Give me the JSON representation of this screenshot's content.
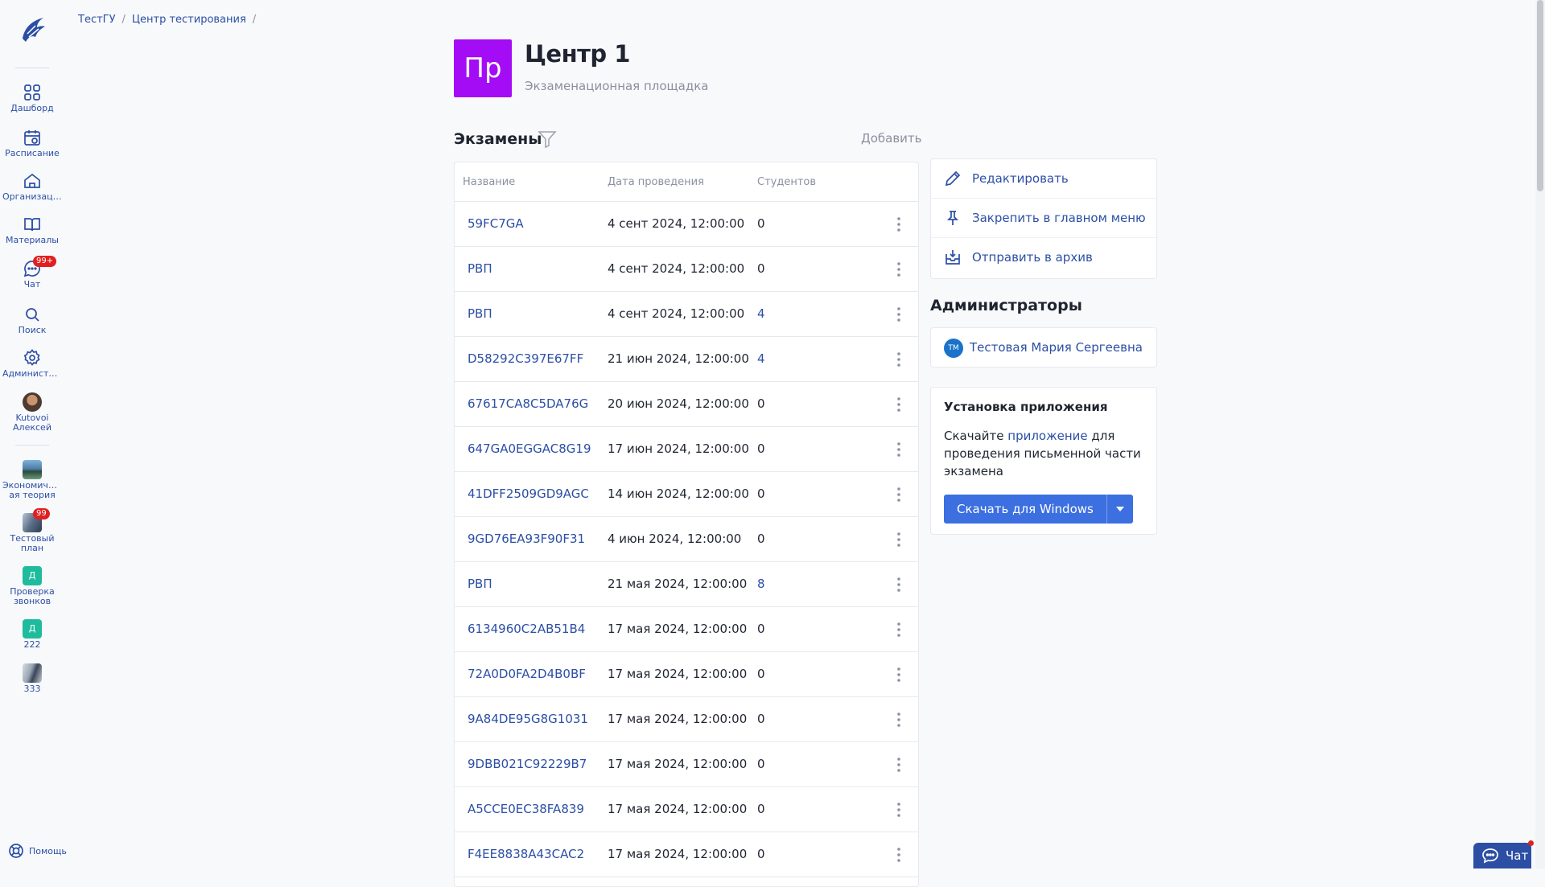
{
  "breadcrumb": {
    "items": [
      "ТестГУ",
      "Центр тестирования"
    ],
    "separator": "/"
  },
  "sidebar": {
    "nav": [
      {
        "label": "Дашборд",
        "icon": "dashboard-icon"
      },
      {
        "label": "Расписание",
        "icon": "calendar-icon"
      },
      {
        "label": "Организация",
        "icon": "organization-icon"
      },
      {
        "label": "Материалы",
        "icon": "book-icon"
      },
      {
        "label": "Чат",
        "icon": "chat-icon",
        "badge": "99+"
      },
      {
        "label": "Поиск",
        "icon": "search-icon"
      },
      {
        "label": "Администрирование",
        "icon": "gear-icon"
      }
    ],
    "user": {
      "label_line1": "Kutovoi",
      "label_line2": "Алексей"
    },
    "courses": [
      {
        "line1": "Экономическ",
        "line2": "ая теория"
      },
      {
        "line1": "Тестовый",
        "line2": "план",
        "badge": "99"
      },
      {
        "letter": "Д",
        "line1": "Проверка",
        "line2": "звонков"
      },
      {
        "letter": "Д",
        "line1": "222"
      },
      {
        "line1": "333"
      }
    ],
    "help_label": "Помощь"
  },
  "header": {
    "avatar_initials": "Пр",
    "title": "Центр 1",
    "subtitle": "Экзаменационная площадка"
  },
  "exams": {
    "title": "Экзамены",
    "add_label": "Добавить",
    "columns": [
      "Название",
      "Дата проведения",
      "Студентов"
    ],
    "rows": [
      {
        "name": "59FC7GA",
        "date": "4 сент 2024, 12:00:00",
        "students": "0"
      },
      {
        "name": "РВП",
        "date": "4 сент 2024, 12:00:00",
        "students": "0"
      },
      {
        "name": "РВП",
        "date": "4 сент 2024, 12:00:00",
        "students": "4"
      },
      {
        "name": "D58292C397E67FF",
        "date": "21 июн 2024, 12:00:00",
        "students": "4"
      },
      {
        "name": "67617CA8C5DA76G",
        "date": "20 июн 2024, 12:00:00",
        "students": "0"
      },
      {
        "name": "647GA0EGGAC8G19",
        "date": "17 июн 2024, 12:00:00",
        "students": "0"
      },
      {
        "name": "41DFF2509GD9AGC",
        "date": "14 июн 2024, 12:00:00",
        "students": "0"
      },
      {
        "name": "9GD76EA93F90F31",
        "date": "4 июн 2024, 12:00:00",
        "students": "0"
      },
      {
        "name": "РВП",
        "date": "21 мая 2024, 12:00:00",
        "students": "8"
      },
      {
        "name": "6134960C2AB51B4",
        "date": "17 мая 2024, 12:00:00",
        "students": "0"
      },
      {
        "name": "72A0D0FA2D4B0BF",
        "date": "17 мая 2024, 12:00:00",
        "students": "0"
      },
      {
        "name": "9A84DE95G8G1031",
        "date": "17 мая 2024, 12:00:00",
        "students": "0"
      },
      {
        "name": "9DBB021C92229B7",
        "date": "17 мая 2024, 12:00:00",
        "students": "0"
      },
      {
        "name": "A5CCE0EC38FA839",
        "date": "17 мая 2024, 12:00:00",
        "students": "0"
      },
      {
        "name": "F4EE8838A43CAC2",
        "date": "17 мая 2024, 12:00:00",
        "students": "0"
      },
      {
        "name": "",
        "date": "",
        "students": ""
      }
    ]
  },
  "actions": [
    {
      "label": "Редактировать",
      "icon": "pencil-icon"
    },
    {
      "label": "Закрепить в главном меню",
      "icon": "pin-icon"
    },
    {
      "label": "Отправить в архив",
      "icon": "archive-icon"
    }
  ],
  "admins": {
    "title": "Администраторы",
    "list": [
      {
        "initials": "ТМ",
        "name": "Тестовая Мария Сергеевна"
      }
    ]
  },
  "install": {
    "title": "Установка приложения",
    "text_before": "Скачайте ",
    "link": "приложение",
    "text_after": " для проведения письменной части экзамена",
    "button": "Скачать для Windows"
  },
  "chat_widget": {
    "label": "Чат"
  },
  "colors": {
    "accent": "#2c4fa5",
    "center_avatar": "#a30cf5",
    "badge": "#e02020",
    "button": "#3c6fe0"
  }
}
